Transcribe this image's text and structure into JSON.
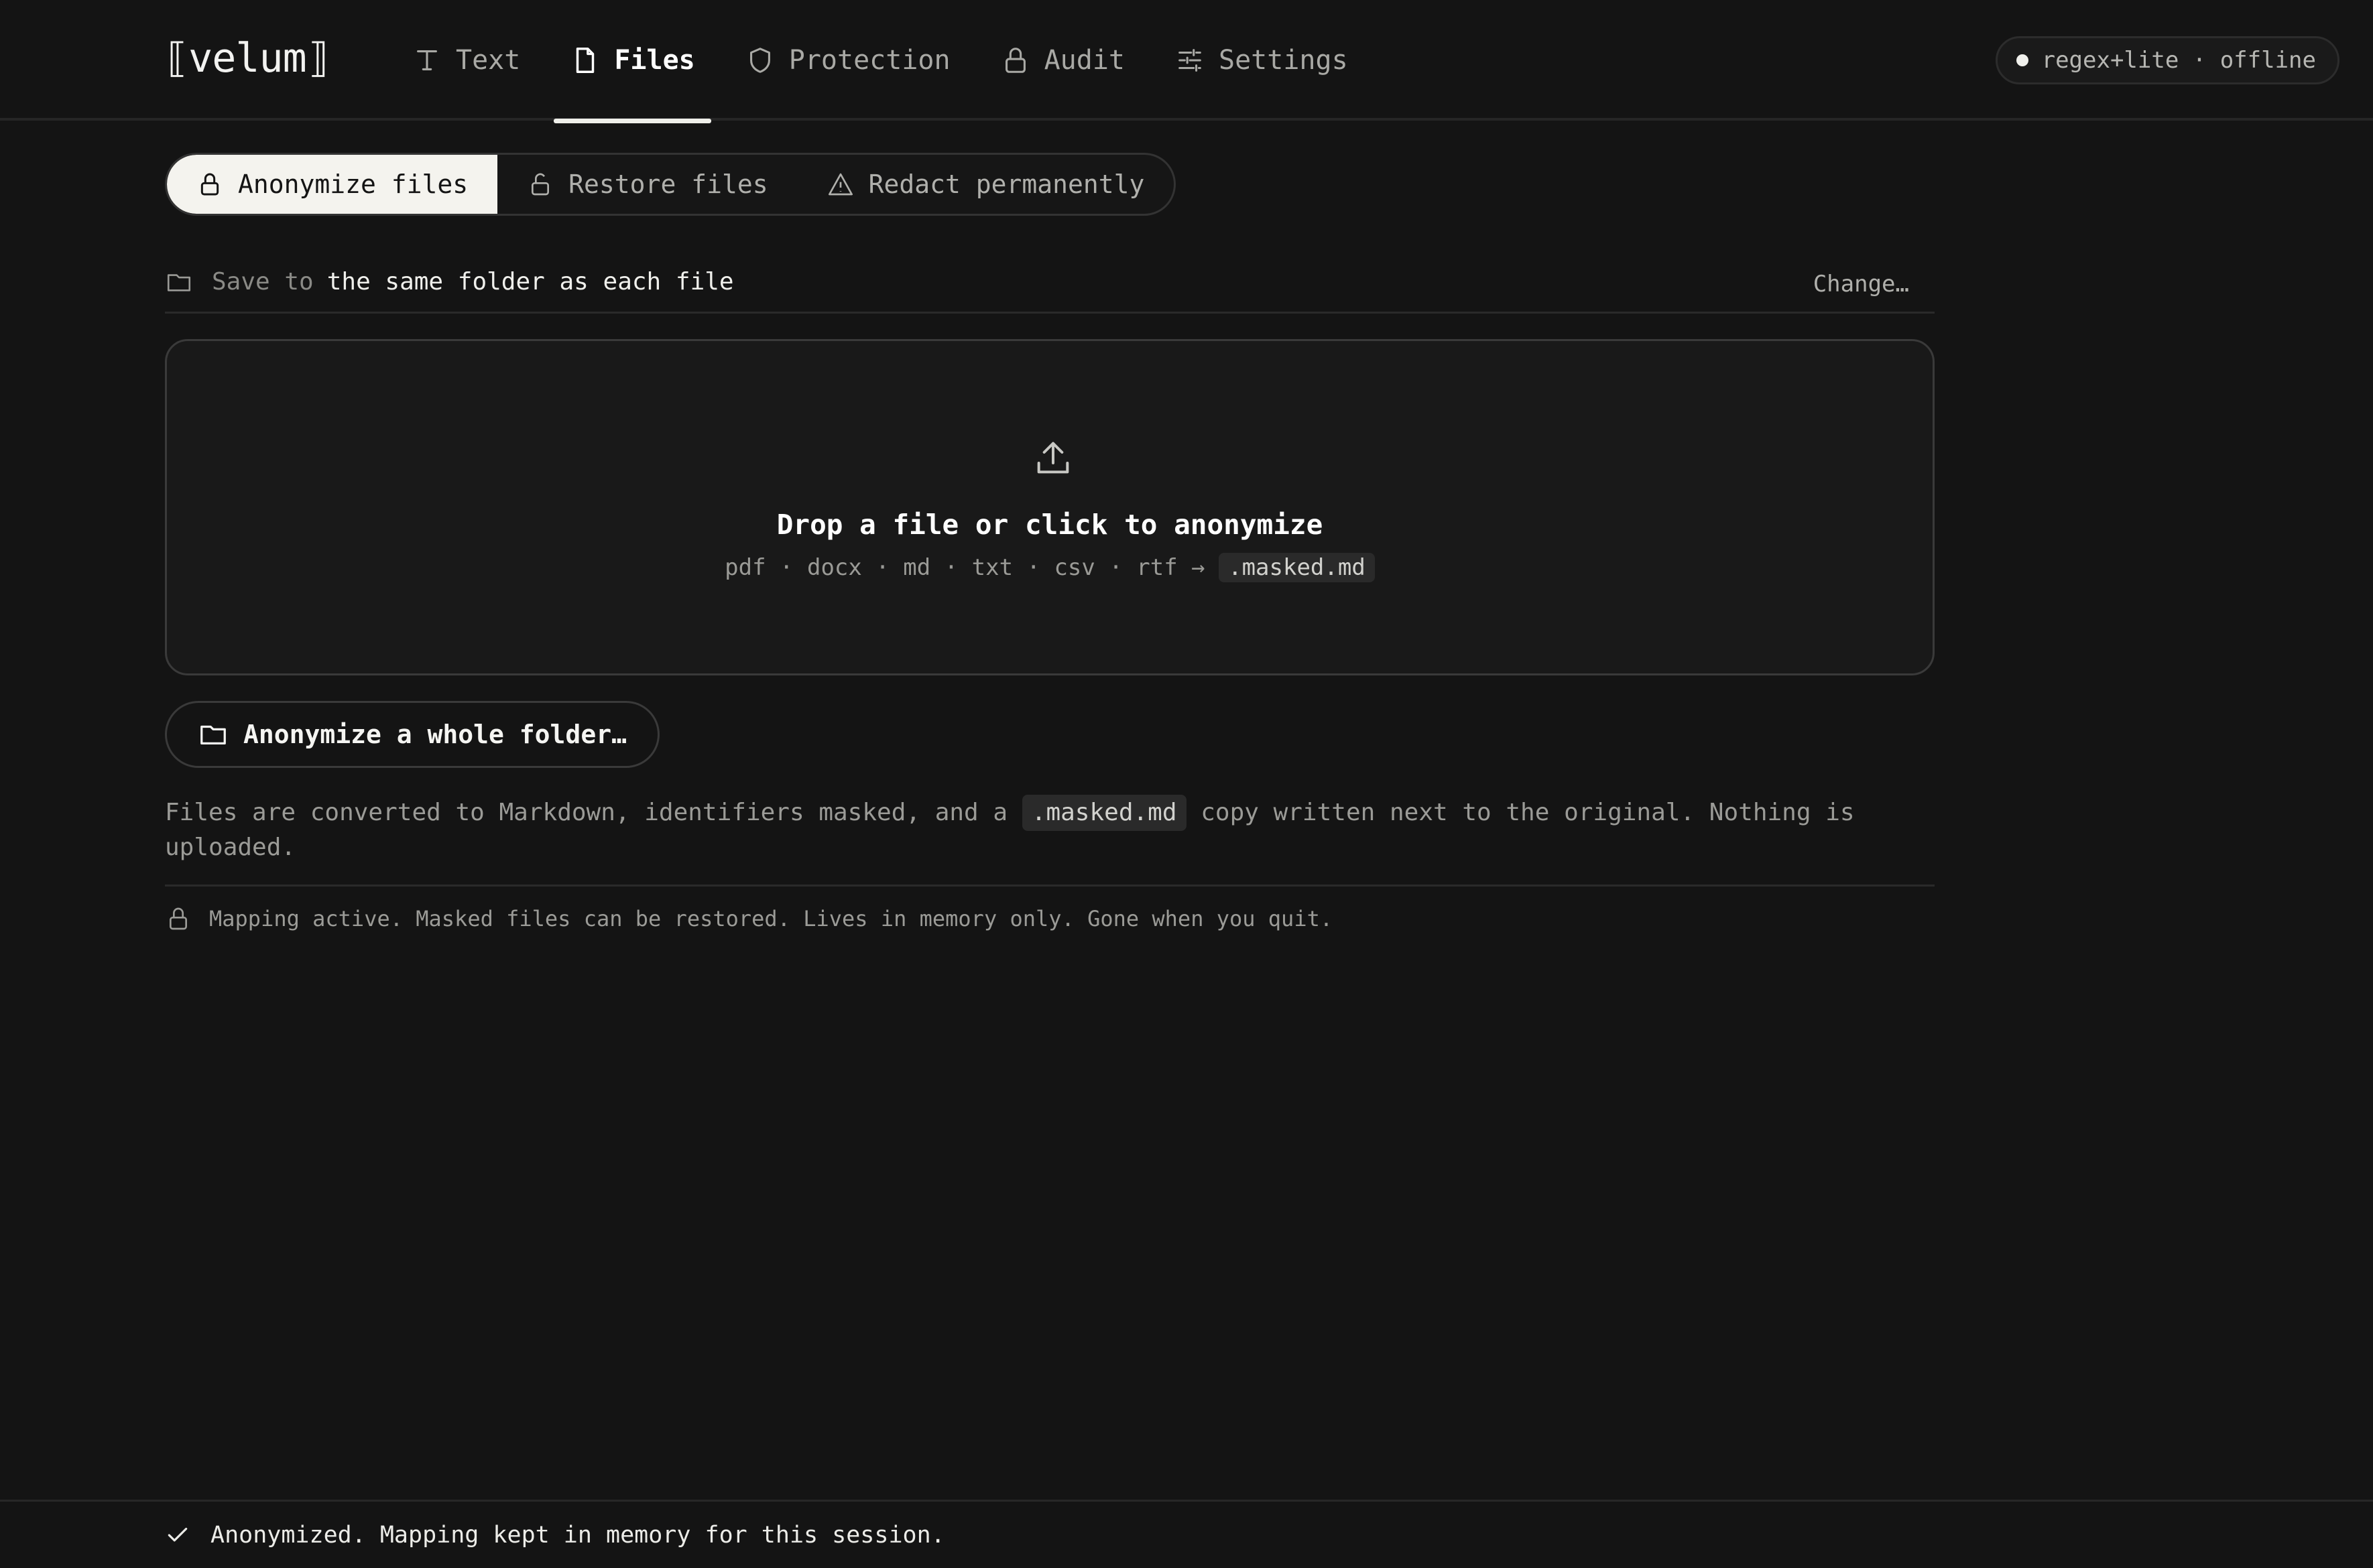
{
  "app": {
    "logo": "⟦velum⟧"
  },
  "nav": {
    "items": [
      {
        "label": "Text",
        "icon": "text-icon"
      },
      {
        "label": "Files",
        "icon": "file-icon",
        "active": true
      },
      {
        "label": "Protection",
        "icon": "shield-icon"
      },
      {
        "label": "Audit",
        "icon": "lock-icon"
      },
      {
        "label": "Settings",
        "icon": "sliders-icon"
      }
    ]
  },
  "status": {
    "text": "regex+lite · offline"
  },
  "modes": {
    "items": [
      {
        "label": "Anonymize files",
        "icon": "lock-icon",
        "active": true
      },
      {
        "label": "Restore files",
        "icon": "unlock-icon"
      },
      {
        "label": "Redact permanently",
        "icon": "warning-icon"
      }
    ]
  },
  "save": {
    "prefix": "Save to",
    "value": "the same folder as each file",
    "change_label": "Change…"
  },
  "dropzone": {
    "title": "Drop a file or click to anonymize",
    "formats": "pdf · docx · md · txt · csv · rtf →",
    "output_ext": ".masked.md"
  },
  "folder_button": {
    "label": "Anonymize a whole folder…"
  },
  "note": {
    "before": "Files are converted to Markdown, identifiers masked, and a",
    "code": ".masked.md",
    "after": "copy written next to the original. Nothing is uploaded."
  },
  "mapping": {
    "text": "Mapping active. Masked files can be restored. Lives in memory only. Gone when you quit."
  },
  "toast": {
    "text": "Anonymized. Mapping kept in memory for this session."
  },
  "colors": {
    "background": "#141414",
    "text": "#e8e8e6",
    "muted": "#9b9b97",
    "active_pill": "#f4f3ee"
  }
}
